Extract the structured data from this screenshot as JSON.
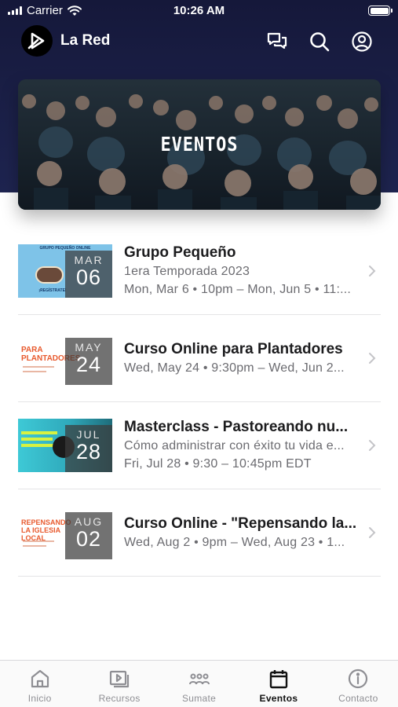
{
  "status_bar": {
    "carrier": "Carrier",
    "time": "10:26 AM"
  },
  "header": {
    "brand": "La Red",
    "icons": [
      "chat-icon",
      "search-icon",
      "account-icon"
    ]
  },
  "banner": {
    "title": "EVENTOS"
  },
  "events": [
    {
      "title": "Grupo Pequeño",
      "line1": "1era Temporada 2023",
      "line2": "Mon, Mar 6 • 10pm – Mon, Jun 5 • 11:...",
      "month": "MAR",
      "day": "06",
      "thumb_top": "GRUPO PEQUEÑO ONLINE",
      "thumb_bottom": "¡REGÍSTRATE!"
    },
    {
      "title": "Curso Online para Plantadores",
      "line1": "Wed, May 24 • 9:30pm – Wed, Jun 2...",
      "month": "MAY",
      "day": "24",
      "thumb_text": "PARA PLANTADORES"
    },
    {
      "title": "Masterclass - Pastoreando nu...",
      "line1": "Cómo administrar con éxito tu vida e...",
      "line2": "Fri, Jul 28 • 9:30 – 10:45pm EDT",
      "month": "JUL",
      "day": "28"
    },
    {
      "title": "Curso Online - \"Repensando la...",
      "line1": "Wed, Aug 2 • 9pm – Wed, Aug 23 • 1...",
      "month": "AUG",
      "day": "02",
      "thumb_text": "REPENSANDO LA IGLESIA LOCAL"
    }
  ],
  "tabs": [
    {
      "label": "Inicio",
      "icon": "home-icon",
      "active": false
    },
    {
      "label": "Recursos",
      "icon": "media-icon",
      "active": false
    },
    {
      "label": "Sumate",
      "icon": "group-icon",
      "active": false
    },
    {
      "label": "Eventos",
      "icon": "calendar-icon",
      "active": true
    },
    {
      "label": "Contacto",
      "icon": "info-icon",
      "active": false
    }
  ],
  "colors": {
    "header_bg": "#1b2048",
    "active_tab": "#111111",
    "inactive_tab": "#8e8e93"
  }
}
